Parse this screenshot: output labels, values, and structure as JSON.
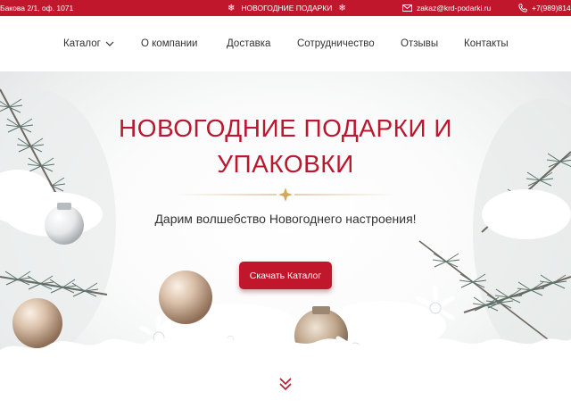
{
  "topbar": {
    "address": "Бакова 2/1, оф. 1071",
    "promo": "НОВОГОДНИЕ ПОДАРКИ",
    "email": "zakaz@krd-podarki.ru",
    "phone": "+7(989)814",
    "icons": [
      "snowflake-icon",
      "mail-icon",
      "phone-icon"
    ],
    "background_color": "#c0172d"
  },
  "nav": {
    "items": [
      {
        "label": "Каталог",
        "has_dropdown": true
      },
      {
        "label": "О компании"
      },
      {
        "label": "Доставка"
      },
      {
        "label": "Сотрудничество"
      },
      {
        "label": "Отзывы"
      },
      {
        "label": "Контакты"
      }
    ]
  },
  "hero": {
    "title_line1": "НОВОГОДНИЕ ПОДАРКИ И",
    "title_line2": "УПАКОВКИ",
    "subtitle": "Дарим волшебство Новогоднего настроения!",
    "cta_label": "Скачать Каталог",
    "accent_color": "#b8192e",
    "icons": [
      "sparkle-divider-icon",
      "chevron-double-down-icon"
    ]
  }
}
